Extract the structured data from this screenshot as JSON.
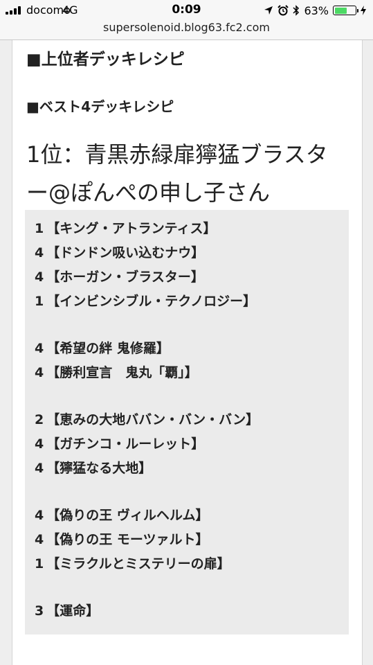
{
  "status_bar": {
    "carrier": "docomo",
    "network": "4G",
    "time": "0:09",
    "battery_percent": "63%",
    "battery_level": 0.63
  },
  "browser": {
    "url": "supersolenoid.blog63.fc2.com"
  },
  "article": {
    "heading": "■上位者デッキレシピ",
    "subheading": "■ベスト4デッキレシピ",
    "title_line1": "1位：青黒赤緑扉獰猛ブラスタ",
    "title_line2": "ー@ぽんぺの申し子さん"
  },
  "deck": [
    {
      "count": "1",
      "name": "【キング・アトランティス】"
    },
    {
      "count": "4",
      "name": "【ドンドン吸い込むナウ】"
    },
    {
      "count": "4",
      "name": "【ホーガン・ブラスター】"
    },
    {
      "count": "1",
      "name": "【インビンシブル・テクノロジー】"
    },
    {
      "count": "4",
      "name": "【希望の絆 鬼修羅】"
    },
    {
      "count": "4",
      "name": "【勝利宣言　鬼丸「覇」】"
    },
    {
      "count": "2",
      "name": "【恵みの大地ババン・バン・バン】"
    },
    {
      "count": "4",
      "name": "【ガチンコ・ルーレット】"
    },
    {
      "count": "4",
      "name": "【獰猛なる大地】"
    },
    {
      "count": "4",
      "name": "【偽りの王 ヴィルヘルム】"
    },
    {
      "count": "4",
      "name": "【偽りの王 モーツァルト】"
    },
    {
      "count": "1",
      "name": "【ミラクルとミステリーの扉】"
    },
    {
      "count": "3",
      "name": "【運命】"
    }
  ]
}
